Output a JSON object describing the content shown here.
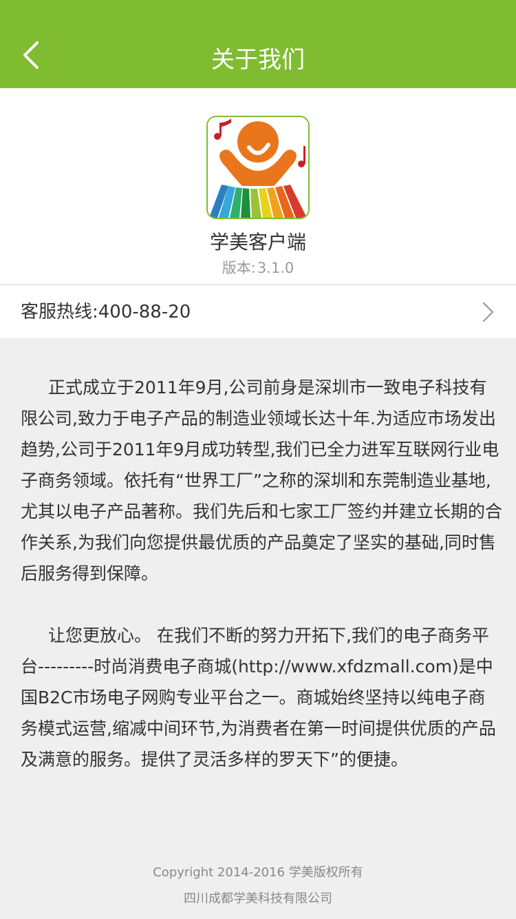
{
  "header": {
    "title": "关于我们",
    "back_icon": "chevron-left-icon",
    "background_color": "#7fbc30"
  },
  "app": {
    "name": "学美客户端",
    "version_label": "版本:",
    "version_value": "3.1.0",
    "icon": "app-logo-icon"
  },
  "hotline": {
    "label": "客服热线:400-88-20",
    "arrow_icon": "chevron-right-icon"
  },
  "content": {
    "paragraphs": [
      "正式成立于2011年9月,公司前身是深圳市一致电子科技有限公司,致力于电子产品的制造业领域长达十年.为适应市场发出趋势,公司于2011年9月成功转型,我们已全力进军互联网行业电子商务领域。依托有“世界工厂”之称的深圳和东莞制造业基地,尤其以电子产品著称。我们先后和七家工厂签约并建立长期的合作关系,为我们向您提供最优质的产品奠定了坚实的基础,同时售后服务得到保障。",
      "让您更放心。 在我们不断的努力开拓下,我们的电子商务平台---------时尚消费电子商城(http://www.xfdzmall.com)是中国B2C市场电子网购专业平台之一。商城始终坚持以纯电子商务模式运营,缩减中间环节,为消费者在第一时间提供优质的产品及满意的服务。提供了灵活多样的罗天下”的便捷。"
    ]
  },
  "footer": {
    "copyright": "Copyright 2014-2016 学美版权所有",
    "company": "四川成都学美科技有限公司"
  }
}
